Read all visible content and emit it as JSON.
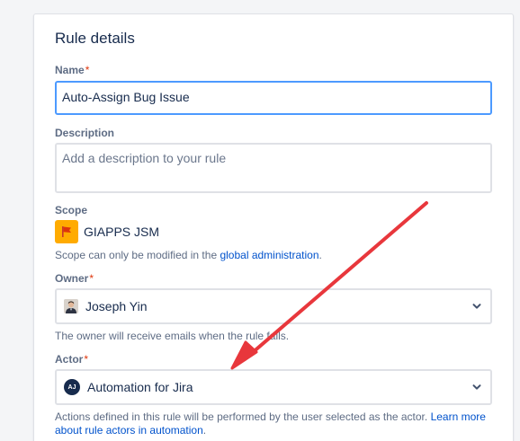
{
  "panel": {
    "title": "Rule details"
  },
  "name": {
    "label": "Name",
    "required_mark": "*",
    "value": "Auto-Assign Bug Issue"
  },
  "description": {
    "label": "Description",
    "placeholder": "Add a description to your rule"
  },
  "scope": {
    "label": "Scope",
    "project_name": "GIAPPS JSM",
    "helper_prefix": "Scope can only be modified in the ",
    "helper_link": "global administration",
    "helper_suffix": "."
  },
  "owner": {
    "label": "Owner",
    "required_mark": "*",
    "value": "Joseph Yin",
    "helper": "The owner will receive emails when the rule fails."
  },
  "actor": {
    "label": "Actor",
    "required_mark": "*",
    "avatar_initials": "AJ",
    "value": "Automation for Jira",
    "helper_prefix": "Actions defined in this rule will be performed by the user selected as the actor. ",
    "helper_link": "Learn more about rule actors in automation",
    "helper_suffix": "."
  },
  "colors": {
    "annotation_arrow": "#e8373c",
    "focus_border": "#4c9aff",
    "link": "#0052cc",
    "scope_badge": "#ffab00"
  },
  "icons": {
    "scope_badge": "flag-icon",
    "select_chevron": "chevron-down-icon"
  }
}
